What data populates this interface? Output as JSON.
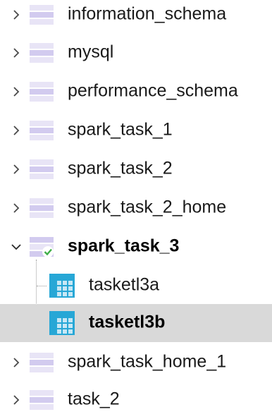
{
  "tree": {
    "items": [
      {
        "label": "information_schema",
        "expanded": false,
        "bold": false
      },
      {
        "label": "mysql",
        "expanded": false,
        "bold": false
      },
      {
        "label": "performance_schema",
        "expanded": false,
        "bold": false
      },
      {
        "label": "spark_task_1",
        "expanded": false,
        "bold": false
      },
      {
        "label": "spark_task_2",
        "expanded": false,
        "bold": false
      },
      {
        "label": "spark_task_2_home",
        "expanded": false,
        "bold": false
      },
      {
        "label": "spark_task_3",
        "expanded": true,
        "bold": true,
        "children": [
          {
            "label": "tasketl3a",
            "selected": false
          },
          {
            "label": "tasketl3b",
            "selected": true
          }
        ]
      },
      {
        "label": "spark_task_home_1",
        "expanded": false,
        "bold": false
      },
      {
        "label": "task_2",
        "expanded": false,
        "bold": false
      }
    ]
  },
  "icons": {
    "collapsed": "chevron-right-icon",
    "expanded": "chevron-down-icon",
    "database": "database-icon",
    "database_active": "database-check-icon",
    "table": "table-icon"
  },
  "colors": {
    "db_stripe_light": "#e8e4f6",
    "db_stripe_dark": "#d2cbef",
    "check_green": "#3fae49",
    "table_blue": "#27a7d6",
    "table_cell": "#c7e7f5",
    "selected_row": "#d9d9d9"
  }
}
